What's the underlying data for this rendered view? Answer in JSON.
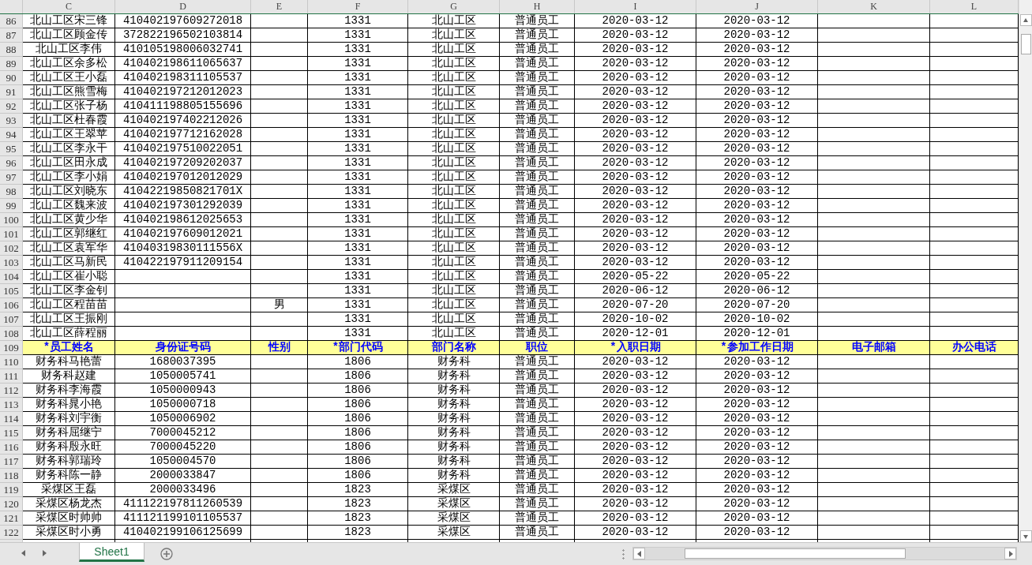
{
  "columns": [
    "C",
    "D",
    "E",
    "F",
    "G",
    "H",
    "I",
    "J",
    "K",
    "L"
  ],
  "rows": [
    {
      "number": "86",
      "kind": "data",
      "cells": {
        "C": "北山工区宋三锋",
        "D": "410402197609272018",
        "F": "1331",
        "G": "北山工区",
        "H": "普通员工",
        "I": "2020-03-12",
        "J": "2020-03-12"
      }
    },
    {
      "number": "87",
      "kind": "data",
      "cells": {
        "C": "北山工区顾金传",
        "D": "372822196502103814",
        "F": "1331",
        "G": "北山工区",
        "H": "普通员工",
        "I": "2020-03-12",
        "J": "2020-03-12"
      }
    },
    {
      "number": "88",
      "kind": "data",
      "cells": {
        "C": "北山工区李伟",
        "D": "410105198006032741",
        "F": "1331",
        "G": "北山工区",
        "H": "普通员工",
        "I": "2020-03-12",
        "J": "2020-03-12"
      }
    },
    {
      "number": "89",
      "kind": "data",
      "cells": {
        "C": "北山工区余多松",
        "D": "410402198611065637",
        "F": "1331",
        "G": "北山工区",
        "H": "普通员工",
        "I": "2020-03-12",
        "J": "2020-03-12"
      }
    },
    {
      "number": "90",
      "kind": "data",
      "cells": {
        "C": "北山工区王小磊",
        "D": "410402198311105537",
        "F": "1331",
        "G": "北山工区",
        "H": "普通员工",
        "I": "2020-03-12",
        "J": "2020-03-12"
      }
    },
    {
      "number": "91",
      "kind": "data",
      "cells": {
        "C": "北山工区熊雪梅",
        "D": "410402197212012023",
        "F": "1331",
        "G": "北山工区",
        "H": "普通员工",
        "I": "2020-03-12",
        "J": "2020-03-12"
      }
    },
    {
      "number": "92",
      "kind": "data",
      "cells": {
        "C": "北山工区张子杨",
        "D": "410411198805155696",
        "F": "1331",
        "G": "北山工区",
        "H": "普通员工",
        "I": "2020-03-12",
        "J": "2020-03-12"
      }
    },
    {
      "number": "93",
      "kind": "data",
      "cells": {
        "C": "北山工区杜春霞",
        "D": "410402197402212026",
        "F": "1331",
        "G": "北山工区",
        "H": "普通员工",
        "I": "2020-03-12",
        "J": "2020-03-12"
      }
    },
    {
      "number": "94",
      "kind": "data",
      "cells": {
        "C": "北山工区王翠苹",
        "D": "410402197712162028",
        "F": "1331",
        "G": "北山工区",
        "H": "普通员工",
        "I": "2020-03-12",
        "J": "2020-03-12"
      }
    },
    {
      "number": "95",
      "kind": "data",
      "cells": {
        "C": "北山工区李永干",
        "D": "410402197510022051",
        "F": "1331",
        "G": "北山工区",
        "H": "普通员工",
        "I": "2020-03-12",
        "J": "2020-03-12"
      }
    },
    {
      "number": "96",
      "kind": "data",
      "cells": {
        "C": "北山工区田永成",
        "D": "410402197209202037",
        "F": "1331",
        "G": "北山工区",
        "H": "普通员工",
        "I": "2020-03-12",
        "J": "2020-03-12"
      }
    },
    {
      "number": "97",
      "kind": "data",
      "cells": {
        "C": "北山工区李小娟",
        "D": "410402197012012029",
        "F": "1331",
        "G": "北山工区",
        "H": "普通员工",
        "I": "2020-03-12",
        "J": "2020-03-12"
      }
    },
    {
      "number": "98",
      "kind": "data",
      "cells": {
        "C": "北山工区刘晓东",
        "D": "41042219850821701X",
        "F": "1331",
        "G": "北山工区",
        "H": "普通员工",
        "I": "2020-03-12",
        "J": "2020-03-12"
      }
    },
    {
      "number": "99",
      "kind": "data",
      "cells": {
        "C": "北山工区魏来波",
        "D": "410402197301292039",
        "F": "1331",
        "G": "北山工区",
        "H": "普通员工",
        "I": "2020-03-12",
        "J": "2020-03-12"
      }
    },
    {
      "number": "100",
      "kind": "data",
      "cells": {
        "C": "北山工区黄少华",
        "D": "410402198612025653",
        "F": "1331",
        "G": "北山工区",
        "H": "普通员工",
        "I": "2020-03-12",
        "J": "2020-03-12"
      }
    },
    {
      "number": "101",
      "kind": "data",
      "cells": {
        "C": "北山工区郭继红",
        "D": "410402197609012021",
        "F": "1331",
        "G": "北山工区",
        "H": "普通员工",
        "I": "2020-03-12",
        "J": "2020-03-12"
      }
    },
    {
      "number": "102",
      "kind": "data",
      "cells": {
        "C": "北山工区袁军华",
        "D": "41040319830111556X",
        "F": "1331",
        "G": "北山工区",
        "H": "普通员工",
        "I": "2020-03-12",
        "J": "2020-03-12"
      }
    },
    {
      "number": "103",
      "kind": "data",
      "cells": {
        "C": "北山工区马新民",
        "D": "410422197911209154",
        "F": "1331",
        "G": "北山工区",
        "H": "普通员工",
        "I": "2020-03-12",
        "J": "2020-03-12"
      }
    },
    {
      "number": "104",
      "kind": "data",
      "cells": {
        "C": "北山工区崔小聪",
        "F": "1331",
        "G": "北山工区",
        "H": "普通员工",
        "I": "2020-05-22",
        "J": "2020-05-22"
      }
    },
    {
      "number": "105",
      "kind": "data",
      "cells": {
        "C": "北山工区李金钊",
        "F": "1331",
        "G": "北山工区",
        "H": "普通员工",
        "I": "2020-06-12",
        "J": "2020-06-12"
      }
    },
    {
      "number": "106",
      "kind": "data",
      "cells": {
        "C": "北山工区程苗苗",
        "E": "男",
        "F": "1331",
        "G": "北山工区",
        "H": "普通员工",
        "I": "2020-07-20",
        "J": "2020-07-20"
      }
    },
    {
      "number": "107",
      "kind": "data",
      "cells": {
        "C": "北山工区王振刚",
        "F": "1331",
        "G": "北山工区",
        "H": "普通员工",
        "I": "2020-10-02",
        "J": "2020-10-02"
      }
    },
    {
      "number": "108",
      "kind": "data",
      "cells": {
        "C": "北山工区薛程丽",
        "F": "1331",
        "G": "北山工区",
        "H": "普通员工",
        "I": "2020-12-01",
        "J": "2020-12-01"
      }
    },
    {
      "number": "109",
      "kind": "header",
      "cells": {
        "C": "*员工姓名",
        "D": "身份证号码",
        "E": "性别",
        "F": "*部门代码",
        "G": "部门名称",
        "H": "职位",
        "I": "*入职日期",
        "J": "*参加工作日期",
        "K": "电子邮箱",
        "L": "办公电话"
      }
    },
    {
      "number": "110",
      "kind": "data",
      "cells": {
        "C": "财务科马艳蕾",
        "D": "1680037395",
        "F": "1806",
        "G": "财务科",
        "H": "普通员工",
        "I": "2020-03-12",
        "J": "2020-03-12"
      }
    },
    {
      "number": "111",
      "kind": "data",
      "cells": {
        "C": "财务科赵建",
        "D": "1050005741",
        "F": "1806",
        "G": "财务科",
        "H": "普通员工",
        "I": "2020-03-12",
        "J": "2020-03-12"
      }
    },
    {
      "number": "112",
      "kind": "data",
      "cells": {
        "C": "财务科李海霞",
        "D": "1050000943",
        "F": "1806",
        "G": "财务科",
        "H": "普通员工",
        "I": "2020-03-12",
        "J": "2020-03-12"
      }
    },
    {
      "number": "113",
      "kind": "data",
      "cells": {
        "C": "财务科晁小艳",
        "D": "1050000718",
        "F": "1806",
        "G": "财务科",
        "H": "普通员工",
        "I": "2020-03-12",
        "J": "2020-03-12"
      }
    },
    {
      "number": "114",
      "kind": "data",
      "cells": {
        "C": "财务科刘宇衡",
        "D": "1050006902",
        "F": "1806",
        "G": "财务科",
        "H": "普通员工",
        "I": "2020-03-12",
        "J": "2020-03-12"
      }
    },
    {
      "number": "115",
      "kind": "data",
      "cells": {
        "C": "财务科屈继宁",
        "D": "7000045212",
        "F": "1806",
        "G": "财务科",
        "H": "普通员工",
        "I": "2020-03-12",
        "J": "2020-03-12"
      }
    },
    {
      "number": "116",
      "kind": "data",
      "cells": {
        "C": "财务科殷永旺",
        "D": "7000045220",
        "F": "1806",
        "G": "财务科",
        "H": "普通员工",
        "I": "2020-03-12",
        "J": "2020-03-12"
      }
    },
    {
      "number": "117",
      "kind": "data",
      "cells": {
        "C": "财务科郭瑞玲",
        "D": "1050004570",
        "F": "1806",
        "G": "财务科",
        "H": "普通员工",
        "I": "2020-03-12",
        "J": "2020-03-12"
      }
    },
    {
      "number": "118",
      "kind": "data",
      "cells": {
        "C": "财务科陈一静",
        "D": "2000033847",
        "F": "1806",
        "G": "财务科",
        "H": "普通员工",
        "I": "2020-03-12",
        "J": "2020-03-12"
      }
    },
    {
      "number": "119",
      "kind": "data",
      "cells": {
        "C": "采煤区王磊",
        "D": "2000033496",
        "F": "1823",
        "G": "采煤区",
        "H": "普通员工",
        "I": "2020-03-12",
        "J": "2020-03-12"
      }
    },
    {
      "number": "120",
      "kind": "data",
      "cells": {
        "C": "采煤区杨龙杰",
        "D": "411122197811260539",
        "F": "1823",
        "G": "采煤区",
        "H": "普通员工",
        "I": "2020-03-12",
        "J": "2020-03-12"
      }
    },
    {
      "number": "121",
      "kind": "data",
      "cells": {
        "C": "采煤区时帅帅",
        "D": "411121199101105537",
        "F": "1823",
        "G": "采煤区",
        "H": "普通员工",
        "I": "2020-03-12",
        "J": "2020-03-12"
      }
    },
    {
      "number": "122",
      "kind": "data",
      "cells": {
        "C": "采煤区时小勇",
        "D": "410402199106125699",
        "F": "1823",
        "G": "采煤区",
        "H": "普通员工",
        "I": "2020-03-12",
        "J": "2020-03-12"
      }
    }
  ],
  "sheet_tabs": [
    {
      "label": "Sheet1",
      "selected": true
    }
  ]
}
